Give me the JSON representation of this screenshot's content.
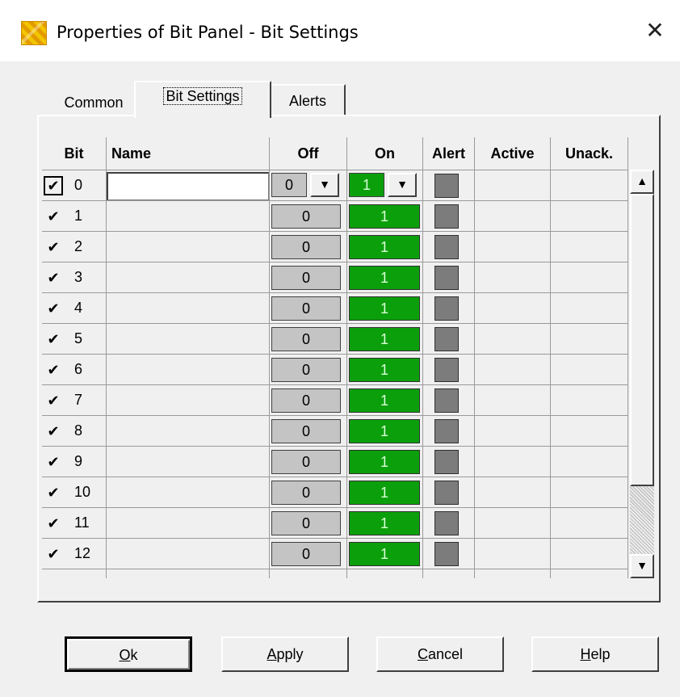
{
  "window": {
    "title": "Properties of Bit Panel - Bit Settings",
    "close_label": "✕",
    "icon": "bit-panel-app-icon"
  },
  "tabs": [
    {
      "label": "Common",
      "active": false
    },
    {
      "label": "Bit Settings",
      "active": true
    },
    {
      "label": "Alerts",
      "active": false
    }
  ],
  "grid": {
    "headers": {
      "bit": "Bit",
      "name": "Name",
      "off": "Off",
      "on": "On",
      "alert": "Alert",
      "active": "Active",
      "unack": "Unack."
    },
    "rows": [
      {
        "check": "✔",
        "bit": "0",
        "off": "0",
        "on": "1"
      },
      {
        "check": "✔",
        "bit": "1",
        "off": "0",
        "on": "1"
      },
      {
        "check": "✔",
        "bit": "2",
        "off": "0",
        "on": "1"
      },
      {
        "check": "✔",
        "bit": "3",
        "off": "0",
        "on": "1"
      },
      {
        "check": "✔",
        "bit": "4",
        "off": "0",
        "on": "1"
      },
      {
        "check": "✔",
        "bit": "5",
        "off": "0",
        "on": "1"
      },
      {
        "check": "✔",
        "bit": "6",
        "off": "0",
        "on": "1"
      },
      {
        "check": "✔",
        "bit": "7",
        "off": "0",
        "on": "1"
      },
      {
        "check": "✔",
        "bit": "8",
        "off": "0",
        "on": "1"
      },
      {
        "check": "✔",
        "bit": "9",
        "off": "0",
        "on": "1"
      },
      {
        "check": "✔",
        "bit": "10",
        "off": "0",
        "on": "1"
      },
      {
        "check": "✔",
        "bit": "11",
        "off": "0",
        "on": "1"
      },
      {
        "check": "✔",
        "bit": "12",
        "off": "0",
        "on": "1"
      }
    ],
    "scroll_up": "▲",
    "scroll_down": "▼",
    "combo_arrow": "▼"
  },
  "colors": {
    "on_green": "#0c9f0c",
    "off_gray": "#c4c4c4",
    "alert_gray": "#7c7c7c"
  },
  "buttons": {
    "ok": {
      "pre": "",
      "key": "O",
      "post": "k"
    },
    "apply": {
      "pre": "",
      "key": "A",
      "post": "pply"
    },
    "cancel": {
      "pre": "",
      "key": "C",
      "post": "ancel"
    },
    "help": {
      "pre": "",
      "key": "H",
      "post": "elp"
    }
  }
}
